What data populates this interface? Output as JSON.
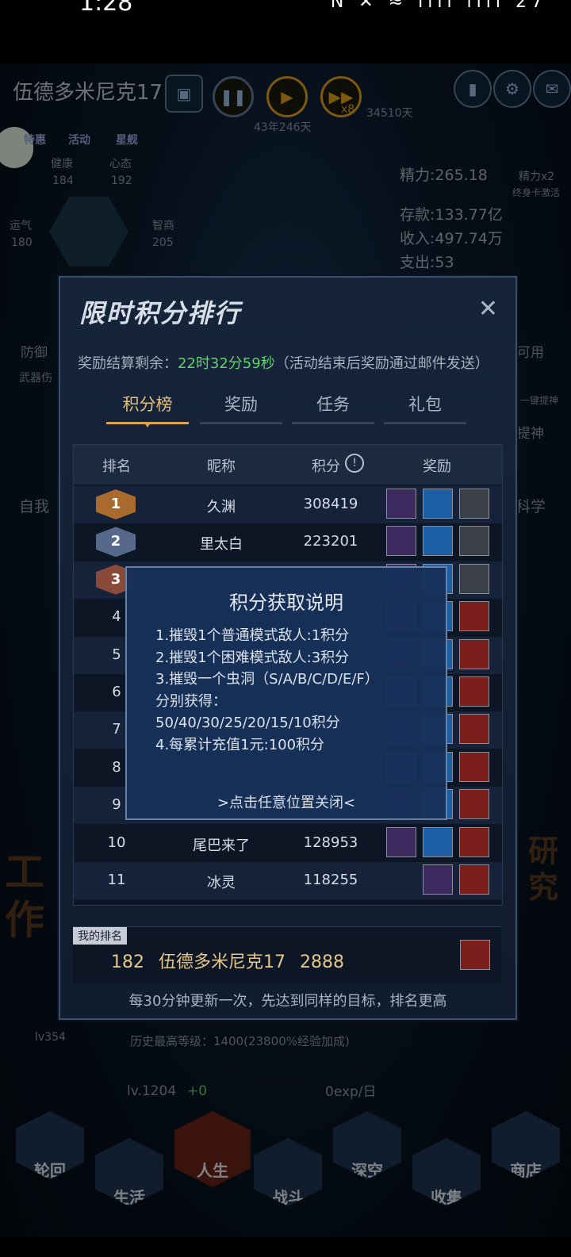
{
  "statusbar": {
    "time": "1:28",
    "icons": "N ✕ ≈ ılıl ılıl 27"
  },
  "hud": {
    "player_name": "伍德多米尼克17",
    "date": "43年246天",
    "speed_label": "x8",
    "days_counter": "34510天",
    "tabs_small": [
      "特惠",
      "活动",
      "星舰"
    ],
    "stats": {
      "health_label": "健康",
      "health": "184",
      "mood_label": "心态",
      "mood": "192",
      "luck_label": "运气",
      "luck": "180",
      "iq_label": "智商",
      "iq": "205"
    },
    "energy": "精力:265.18",
    "energy_bonus": "精力x2",
    "energy_note": "终身卡激活",
    "savings": "存款:133.77亿",
    "income": "收入:497.74万",
    "expense": "支出:53",
    "defense": "防御",
    "weapon": "武器伤",
    "available": "可用",
    "boost": "一键提神",
    "boost2": "提神",
    "side_left": "自我",
    "side_right": "科学",
    "big_left": "工作",
    "big_right": "研究",
    "level_line": "历史最高等级：1400(23800%经验加成)",
    "level": "lv.1204",
    "level_delta": "+0",
    "exp_rate": "0exp/日",
    "badge_level": "lv354"
  },
  "nav": [
    "轮回",
    "生活",
    "人生",
    "战斗",
    "深空",
    "收集",
    "商店"
  ],
  "modal": {
    "title": "限时积分排行",
    "countdown_label": "奖励结算剩余：",
    "countdown_value": "22时32分59秒",
    "countdown_note": "（活动结束后奖励通过邮件发送）",
    "tabs": [
      "积分榜",
      "奖励",
      "任务",
      "礼包"
    ],
    "headers": [
      "排名",
      "昵称",
      "积分",
      "奖励"
    ],
    "rows": [
      {
        "rank": "1",
        "name": "久渊",
        "score": "308419"
      },
      {
        "rank": "2",
        "name": "里太白",
        "score": "223201"
      },
      {
        "rank": "3",
        "name": "",
        "score": ""
      },
      {
        "rank": "4",
        "name": "",
        "score": ""
      },
      {
        "rank": "5",
        "name": "",
        "score": ""
      },
      {
        "rank": "6",
        "name": "",
        "score": ""
      },
      {
        "rank": "7",
        "name": "",
        "score": ""
      },
      {
        "rank": "8",
        "name": "",
        "score": ""
      },
      {
        "rank": "9",
        "name": "",
        "score": ""
      },
      {
        "rank": "10",
        "name": "尾巴来了",
        "score": "128953"
      },
      {
        "rank": "11",
        "name": "冰灵",
        "score": "118255"
      }
    ],
    "my_rank_tag": "我的排名",
    "my_rank": "182",
    "my_name": "伍德多米尼克17",
    "my_score": "2888",
    "footnote": "每30分钟更新一次，先达到同样的目标，排名更高"
  },
  "popup": {
    "title": "积分获取说明",
    "lines": [
      "1.摧毁1个普通模式敌人:1积分",
      "2.摧毁1个困难模式敌人:3积分",
      "3.摧毁一个虫洞（S/A/B/C/D/E/F）",
      "分别获得：",
      "50/40/30/25/20/15/10积分",
      "4.每累计充值1元:100积分"
    ],
    "close_hint": ">点击任意位置关闭<"
  }
}
